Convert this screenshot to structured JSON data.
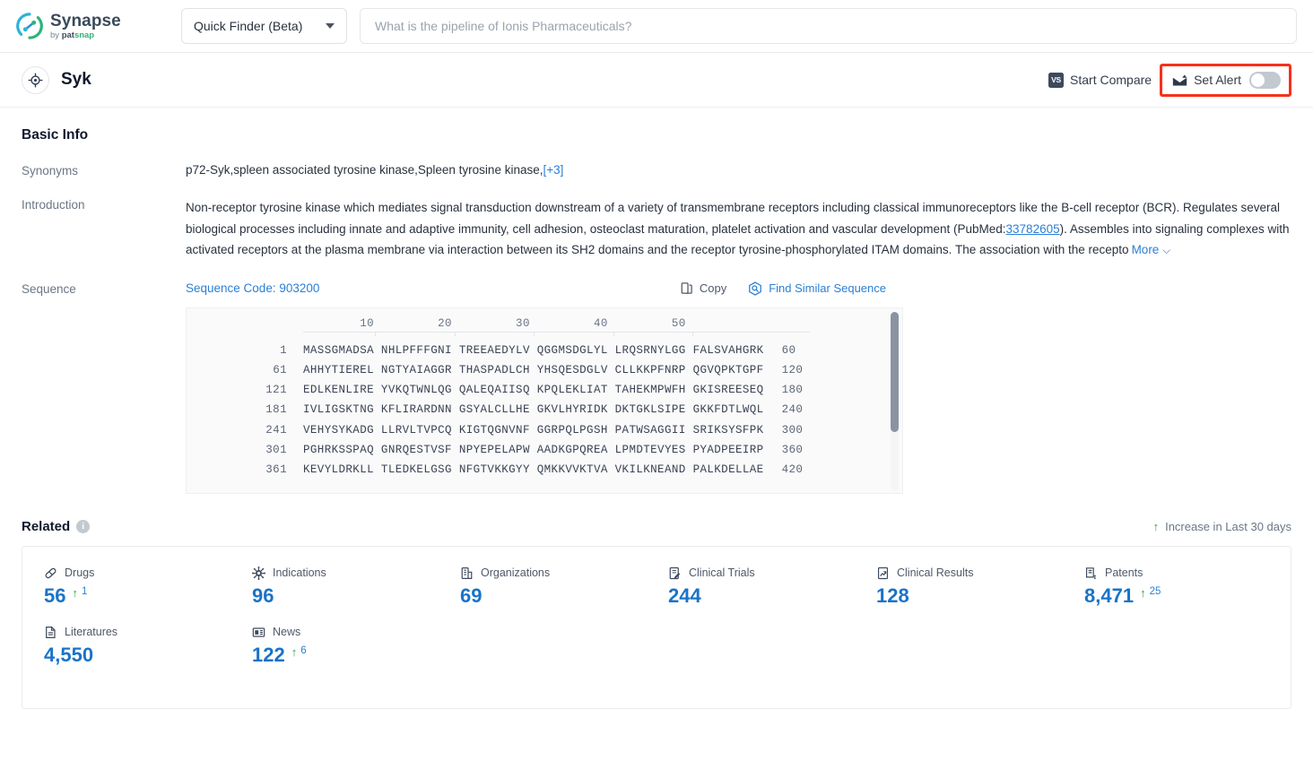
{
  "brand": {
    "name": "Synapse",
    "by": "by ",
    "pat": "pat",
    "snap": "snap"
  },
  "topbar": {
    "finder_label": "Quick Finder (Beta)",
    "search_placeholder": "What is the pipeline of Ionis Pharmaceuticals?",
    "search_value": ""
  },
  "entity": {
    "name": "Syk",
    "start_compare": "Start Compare",
    "vs_badge": "VS",
    "set_alert": "Set Alert",
    "alert_enabled": false,
    "highlight_color": "#f8301a"
  },
  "basic_info": {
    "title": "Basic Info",
    "synonyms_label": "Synonyms",
    "synonyms_value": "p72-Syk,spleen associated tyrosine kinase,Spleen tyrosine kinase,",
    "synonyms_more": "[+3]",
    "introduction_label": "Introduction",
    "introduction_p1": "Non-receptor tyrosine kinase which mediates signal transduction downstream of a variety of transmembrane receptors including classical immunoreceptors like the B-cell receptor (BCR). Regulates several biological processes including innate and adaptive immunity, cell adhesion, osteoclast maturation, platelet activation and vascular development (PubMed:",
    "introduction_pubmed": "33782605",
    "introduction_p2": "). Assembles into signaling complexes with activated receptors at the plasma membrane via interaction between its SH2 domains and the receptor tyrosine-phosphorylated ITAM domains. The association with the recepto",
    "introduction_more": "More"
  },
  "sequence": {
    "label": "Sequence",
    "code_text": "Sequence Code: 903200",
    "copy_label": "Copy",
    "find_similar_label": "Find Similar Sequence",
    "ruler_ticks": [
      "10",
      "20",
      "30",
      "40",
      "50"
    ],
    "rows": [
      {
        "start": "1",
        "blocks": "MASSGMADSA NHLPFFFGNI TREEAEDYLV QGGMSDGLYL LRQSRNYLGG FALSVAHGRK",
        "end": "60"
      },
      {
        "start": "61",
        "blocks": "AHHYTIEREL NGTYAIAGGR THASPADLCH YHSQESDGLV CLLKKPFNRP QGVQPKTGPF",
        "end": "120"
      },
      {
        "start": "121",
        "blocks": "EDLKENLIRE YVKQTWNLQG QALEQAIISQ KPQLEKLIAT TAHEKMPWFH GKISREESEQ",
        "end": "180"
      },
      {
        "start": "181",
        "blocks": "IVLIGSKTNG KFLIRARDNN GSYALCLLHE GKVLHYRIDK DKTGKLSIPE GKKFDTLWQL",
        "end": "240"
      },
      {
        "start": "241",
        "blocks": "VEHYSYKADG LLRVLTVPCQ KIGTQGNVNF GGRPQLPGSH PATWSAGGII SRIKSYSFPK",
        "end": "300"
      },
      {
        "start": "301",
        "blocks": "PGHRKSSPAQ GNRQESTVSF NPYEPELAPW AADKGPQREA LPMDTEVYES PYADPEEIRP",
        "end": "360"
      },
      {
        "start": "361",
        "blocks": "KEVYLDRKLL TLEDKELGSG NFGTVKKGYY QMKKVVKTVA VKILKNEAND PALKDELLAE",
        "end": "420"
      }
    ]
  },
  "related": {
    "title": "Related",
    "legend": "Increase in Last 30 days",
    "stats": [
      {
        "icon": "pill-icon",
        "label": "Drugs",
        "value": "56",
        "delta": "1"
      },
      {
        "icon": "virus-icon",
        "label": "Indications",
        "value": "96",
        "delta": ""
      },
      {
        "icon": "building-icon",
        "label": "Organizations",
        "value": "69",
        "delta": ""
      },
      {
        "icon": "clinical-trial-icon",
        "label": "Clinical Trials",
        "value": "244",
        "delta": ""
      },
      {
        "icon": "clinical-result-icon",
        "label": "Clinical Results",
        "value": "128",
        "delta": ""
      },
      {
        "icon": "patent-icon",
        "label": "Patents",
        "value": "8,471",
        "delta": "25"
      },
      {
        "icon": "literature-icon",
        "label": "Literatures",
        "value": "4,550",
        "delta": ""
      },
      {
        "icon": "news-icon",
        "label": "News",
        "value": "122",
        "delta": "6"
      }
    ]
  },
  "colors": {
    "accent_blue": "#2b7fd4",
    "stat_blue": "#1a73c8",
    "up_green": "#2fa24a"
  }
}
